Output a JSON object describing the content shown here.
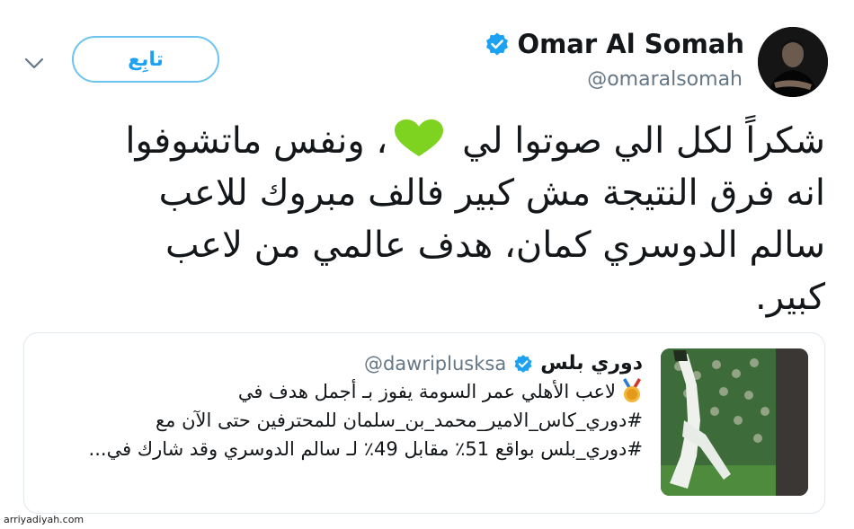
{
  "header": {
    "follow_label": "تابِع",
    "display_name": "Omar Al Somah",
    "handle": "@omaralsomah"
  },
  "tweet": {
    "lines": [
      "شكراً لكل الي صوتوا لي",
      "، ونفس ماتشوفوا",
      "انه فرق النتيجة مش كبير فالف مبروك للاعب",
      "سالم الدوسري كمان، هدف عالمي من لاعب",
      "كبير."
    ],
    "emoji": "green-heart"
  },
  "quote": {
    "name": "دوري بلس",
    "handle": "@dawriplusksa",
    "lines": [
      "لاعب الأهلي عمر السومة يفوز بـ أجمل هدف في",
      "#دوري_كاس_الامير_محمد_بن_سلمان للمحترفين حتى الآن مع",
      "#دوري_بلس بواقع 51٪ مقابل 49٪ لـ سالم الدوسري وقد شارك في..."
    ],
    "emoji": "medal"
  },
  "watermark": "arriyadiyah.com",
  "colors": {
    "accent": "#1da1f2",
    "text": "#14171a",
    "muted": "#657786",
    "border": "#e1e8ed",
    "heart": "#7ed321"
  }
}
